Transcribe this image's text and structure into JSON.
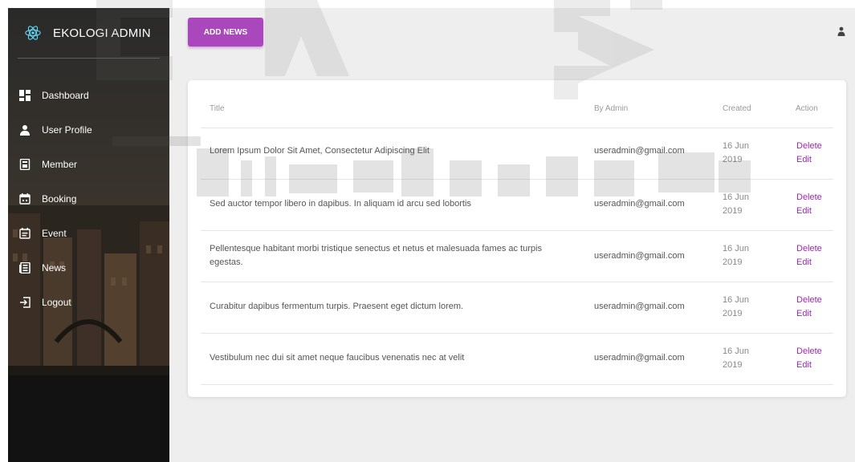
{
  "sidebar": {
    "brand": "EKOLOGI ADMIN",
    "items": [
      {
        "label": "Dashboard",
        "icon": "dashboard-icon"
      },
      {
        "label": "User Profile",
        "icon": "person-icon"
      },
      {
        "label": "Member",
        "icon": "badge-icon"
      },
      {
        "label": "Booking",
        "icon": "calendar-icon"
      },
      {
        "label": "Event",
        "icon": "event-note-icon"
      },
      {
        "label": "News",
        "icon": "news-icon"
      },
      {
        "label": "Logout",
        "icon": "logout-icon"
      }
    ]
  },
  "header": {
    "add_label": "ADD NEWS"
  },
  "table": {
    "headers": {
      "title": "Title",
      "by": "By Admin",
      "created": "Created",
      "action": "Action"
    },
    "rows": [
      {
        "title": "Lorem Ipsum Dolor Sit Amet, Consectetur Adipiscing Elit",
        "by": "useradmin@gmail.com",
        "date1": "16 Jun",
        "date2": "2019",
        "delete": "Delete",
        "edit": "Edit"
      },
      {
        "title": "Sed auctor tempor libero in dapibus. In aliquam id arcu sed lobortis",
        "by": "useradmin@gmail.com",
        "date1": "16 Jun",
        "date2": "2019",
        "delete": "Delete",
        "edit": "Edit"
      },
      {
        "title": "Pellentesque habitant morbi tristique senectus et netus et malesuada fames ac turpis",
        "title2": "egestas.",
        "by": "useradmin@gmail.com",
        "date1": "16 Jun",
        "date2": "2019",
        "delete": "Delete",
        "edit": "Edit"
      },
      {
        "title": "Curabitur dapibus fermentum turpis. Praesent eget dictum lorem.",
        "by": "useradmin@gmail.com",
        "date1": "16 Jun",
        "date2": "2019",
        "delete": "Delete",
        "edit": "Edit"
      },
      {
        "title": "Vestibulum nec dui sit amet neque faucibus venenatis nec at velit",
        "by": "useradmin@gmail.com",
        "date1": "16 Jun",
        "date2": "2019",
        "delete": "Delete",
        "edit": "Edit"
      }
    ]
  },
  "colors": {
    "accent": "#9c27b0",
    "button": "#ab47bc",
    "sidebar_bg": "#2a2a2a"
  }
}
